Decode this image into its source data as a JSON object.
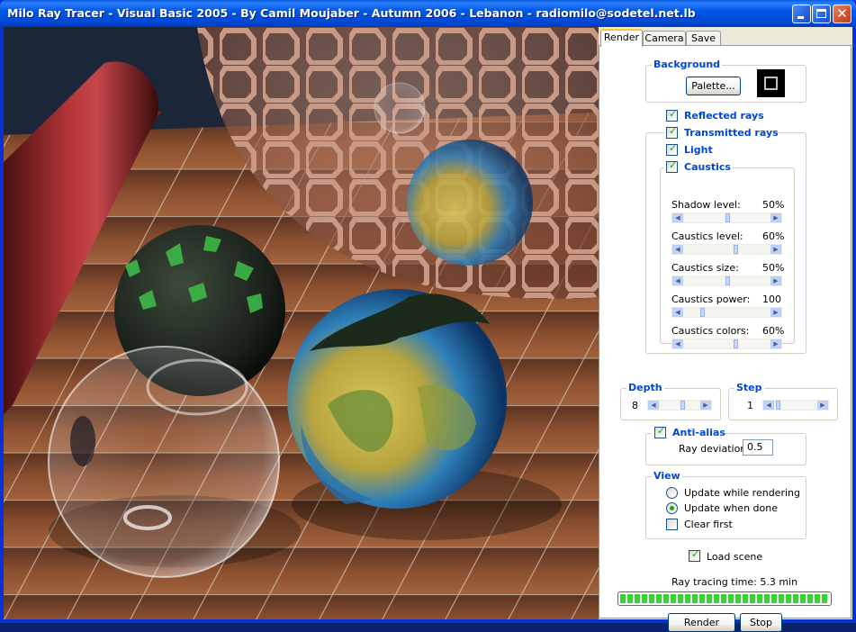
{
  "window": {
    "title": "Milo Ray Tracer - Visual Basic 2005 - By Camil Moujaber - Autumn 2006 - Lebanon - radiomilo@sodetel.net.lb",
    "controls": [
      "minimize-icon",
      "maximize-icon",
      "close-icon"
    ]
  },
  "tabs": [
    {
      "label": "Render",
      "active": true
    },
    {
      "label": "Camera",
      "active": false
    },
    {
      "label": "Save",
      "active": false
    }
  ],
  "background": {
    "label": "Background",
    "palette_button": "Palette...",
    "swatch_color": "#000000"
  },
  "options": {
    "reflected_rays": {
      "label": "Reflected rays",
      "checked": true
    },
    "transmitted_rays": {
      "label": "Transmitted rays",
      "checked": true
    },
    "light": {
      "label": "Light",
      "checked": true
    },
    "caustics": {
      "label": "Caustics",
      "checked": true
    }
  },
  "sliders": [
    {
      "label": "Shadow level:",
      "value": "50%",
      "fraction": 0.5
    },
    {
      "label": "Caustics level:",
      "value": "60%",
      "fraction": 0.6
    },
    {
      "label": "Caustics size:",
      "value": "50%",
      "fraction": 0.5
    },
    {
      "label": "Caustics power:",
      "value": "100",
      "fraction": 0.2
    },
    {
      "label": "Caustics colors:",
      "value": "60%",
      "fraction": 0.6
    }
  ],
  "depth": {
    "label": "Depth",
    "value": "8",
    "fraction": 0.55
  },
  "step": {
    "label": "Step",
    "value": "1",
    "fraction": 0.05
  },
  "antialias": {
    "label": "Anti-alias",
    "checked": true,
    "deviation_label": "Ray deviation:",
    "deviation_value": "0.5"
  },
  "view": {
    "label": "View",
    "update_while_rendering": {
      "label": "Update while rendering",
      "selected": false
    },
    "update_when_done": {
      "label": "Update when done",
      "selected": true
    },
    "clear_first": {
      "label": "Clear first",
      "checked": false
    }
  },
  "load_scene": {
    "label": "Load scene",
    "checked": true
  },
  "ray_tracing_time": "Ray tracing time: 5.3 min",
  "progress": 1.0,
  "buttons": {
    "render": "Render",
    "stop": "Stop"
  },
  "colors": {
    "title_blue": "#0054e3",
    "group_label_blue": "#0046d5",
    "check_green": "#21a121"
  }
}
